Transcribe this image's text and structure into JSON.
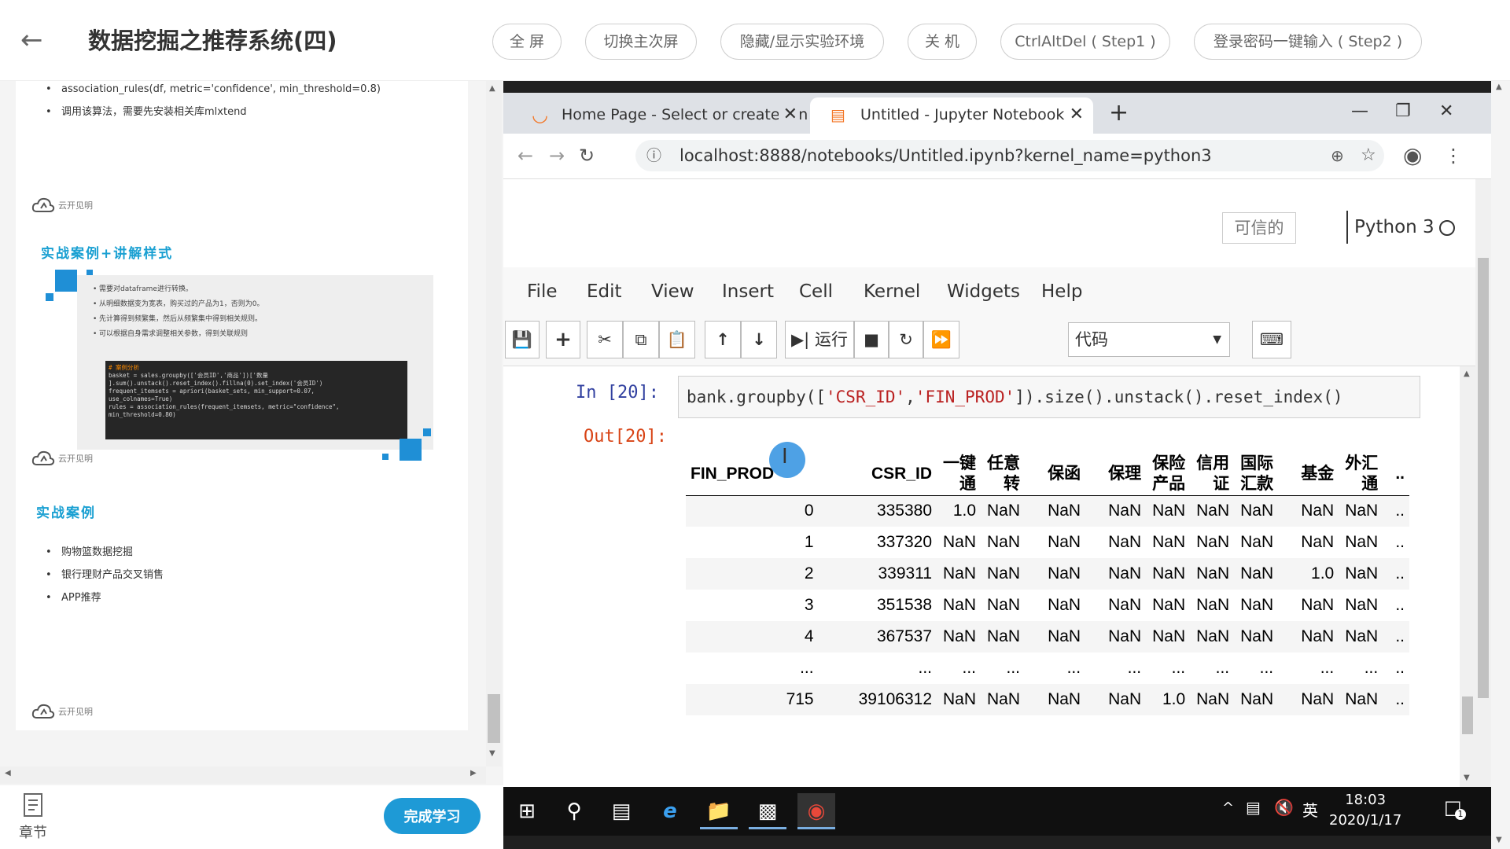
{
  "topbar": {
    "title": "数据挖掘之推荐系统(四)",
    "buttons": [
      "全 屏",
      "切换主次屏",
      "隐藏/显示实验环境",
      "关 机",
      "CtrlAltDel ( Step1 )",
      "登录密码一键输入 ( Step2 )"
    ]
  },
  "slide": {
    "top_bullets": [
      "association_rules(df, metric='confidence', min_threshold=0.8)",
      "调用该算法，需要先安装相关库mlxtend"
    ],
    "logo_text": "云开见明",
    "section1_title": "实战案例+讲解样式",
    "case_bullets": [
      "需要对dataframe进行转换。",
      "从明细数据变为宽表，购买过的产品为1，否则为0。",
      "先计算得到频繁集，然后从频繁集中得到相关规则。",
      "可以根据自身需求调整相关参数，得到关联规则"
    ],
    "code_lines": [
      "# 案例分析",
      "basket = sales.groupby(['会员ID','商品'])['数量",
      "].sum().unstack().reset_index().fillna(0).set_index('会员ID')",
      "frequent_itemsets = apriori(basket_sets, min_support=0.07,",
      "use_colnames=True)",
      "rules = association_rules(frequent_itemsets, metric=\"confidence\",",
      "min_threshold=0.80)"
    ],
    "section2_title": "实战案例",
    "case2_bullets": [
      "购物篮数据挖掘",
      "银行理财产品交叉销售",
      "APP推荐"
    ]
  },
  "footer": {
    "chapter_label": "章节",
    "finish_label": "完成学习"
  },
  "browser": {
    "tabs": [
      {
        "title": "Home Page - Select or create a notebook"
      },
      {
        "title": "Untitled - Jupyter Notebook"
      }
    ],
    "url": "localhost:8888/notebooks/Untitled.ipynb?kernel_name=python3"
  },
  "jupyter": {
    "trusted_label": "可信的",
    "kernel_name": "Python 3",
    "menus": [
      "File",
      "Edit",
      "View",
      "Insert",
      "Cell",
      "Kernel",
      "Widgets",
      "Help"
    ],
    "run_label": "运行",
    "cell_type": "代码",
    "in_prompt": "In  [20]:",
    "out_prompt": "Out[20]:",
    "code": {
      "p1": "bank.groupby([",
      "s1": "'CSR_ID'",
      "p2": ",",
      "s2": "'FIN_PROD'",
      "p3": "]).size().unstack().reset_index()"
    },
    "table": {
      "index_header": "FIN_PROD",
      "headers": [
        "CSR_ID",
        "一键通",
        "任意转",
        "保函",
        "保理",
        "保险产品",
        "信用证",
        "国际汇款",
        "基金",
        "外汇通",
        ".."
      ],
      "rows": [
        [
          "0",
          "335380",
          "1.0",
          "NaN",
          "NaN",
          "NaN",
          "NaN",
          "NaN",
          "NaN",
          "NaN",
          "NaN",
          ".."
        ],
        [
          "1",
          "337320",
          "NaN",
          "NaN",
          "NaN",
          "NaN",
          "NaN",
          "NaN",
          "NaN",
          "NaN",
          "NaN",
          ".."
        ],
        [
          "2",
          "339311",
          "NaN",
          "NaN",
          "NaN",
          "NaN",
          "NaN",
          "NaN",
          "NaN",
          "1.0",
          "NaN",
          ".."
        ],
        [
          "3",
          "351538",
          "NaN",
          "NaN",
          "NaN",
          "NaN",
          "NaN",
          "NaN",
          "NaN",
          "NaN",
          "NaN",
          ".."
        ],
        [
          "4",
          "367537",
          "NaN",
          "NaN",
          "NaN",
          "NaN",
          "NaN",
          "NaN",
          "NaN",
          "NaN",
          "NaN",
          ".."
        ],
        [
          "...",
          "...",
          "...",
          "...",
          "...",
          "...",
          "...",
          "...",
          "...",
          "...",
          "...",
          ".."
        ],
        [
          "715",
          "39106312",
          "NaN",
          "NaN",
          "NaN",
          "NaN",
          "1.0",
          "NaN",
          "NaN",
          "NaN",
          "NaN",
          ".."
        ]
      ]
    }
  },
  "taskbar": {
    "ime": "英",
    "time": "18:03",
    "date": "2020/1/17",
    "notif_count": "1"
  },
  "colors": {
    "accent": "#1e9ad6",
    "in_prompt": "#303f9f",
    "out_prompt": "#d84315"
  }
}
